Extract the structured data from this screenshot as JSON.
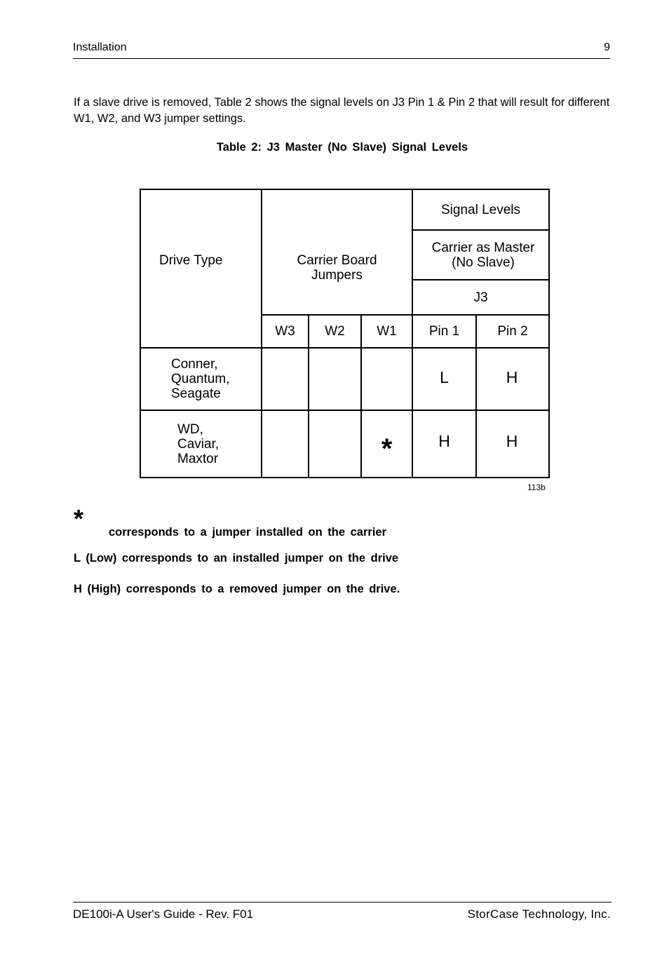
{
  "header": {
    "section": "Installation",
    "page_number": "9"
  },
  "intro": "If a slave drive is removed, Table 2 shows the signal levels on J3 Pin 1 & Pin 2 that will result for different W1, W2, and W3 jumper settings.",
  "table": {
    "caption": "Table 2:  J3 Master (No Slave) Signal Levels",
    "headers": {
      "drive_type": "Drive Type",
      "carrier_board_jumpers": [
        "Carrier Board",
        "Jumpers"
      ],
      "signal_levels": "Signal Levels",
      "carrier_as_master": [
        "Carrier as Master",
        "(No Slave)"
      ],
      "connector": "J3",
      "jumpers": [
        "W3",
        "W2",
        "W1"
      ],
      "pins": [
        "Pin 1",
        "Pin 2"
      ]
    },
    "rows": [
      {
        "drive_type": [
          "Conner,",
          "Quantum,",
          "Seagate"
        ],
        "w3": "",
        "w2": "",
        "w1": "",
        "pin1": "L",
        "pin2": "H"
      },
      {
        "drive_type": [
          "WD,",
          "Caviar,",
          "Maxtor"
        ],
        "w3": "",
        "w2": "",
        "w1": "*",
        "pin1": "H",
        "pin2": "H"
      }
    ],
    "figure_number": "113b"
  },
  "legend": {
    "star_symbol": "*",
    "star_text": "corresponds to a jumper installed on the carrier",
    "low": "L (Low) corresponds to an installed jumper on the drive",
    "high": "H (High) corresponds to a removed jumper on the drive."
  },
  "footer": {
    "left": "DE100i-A User's Guide - Rev. F01",
    "right": "StorCase Technology, Inc."
  }
}
